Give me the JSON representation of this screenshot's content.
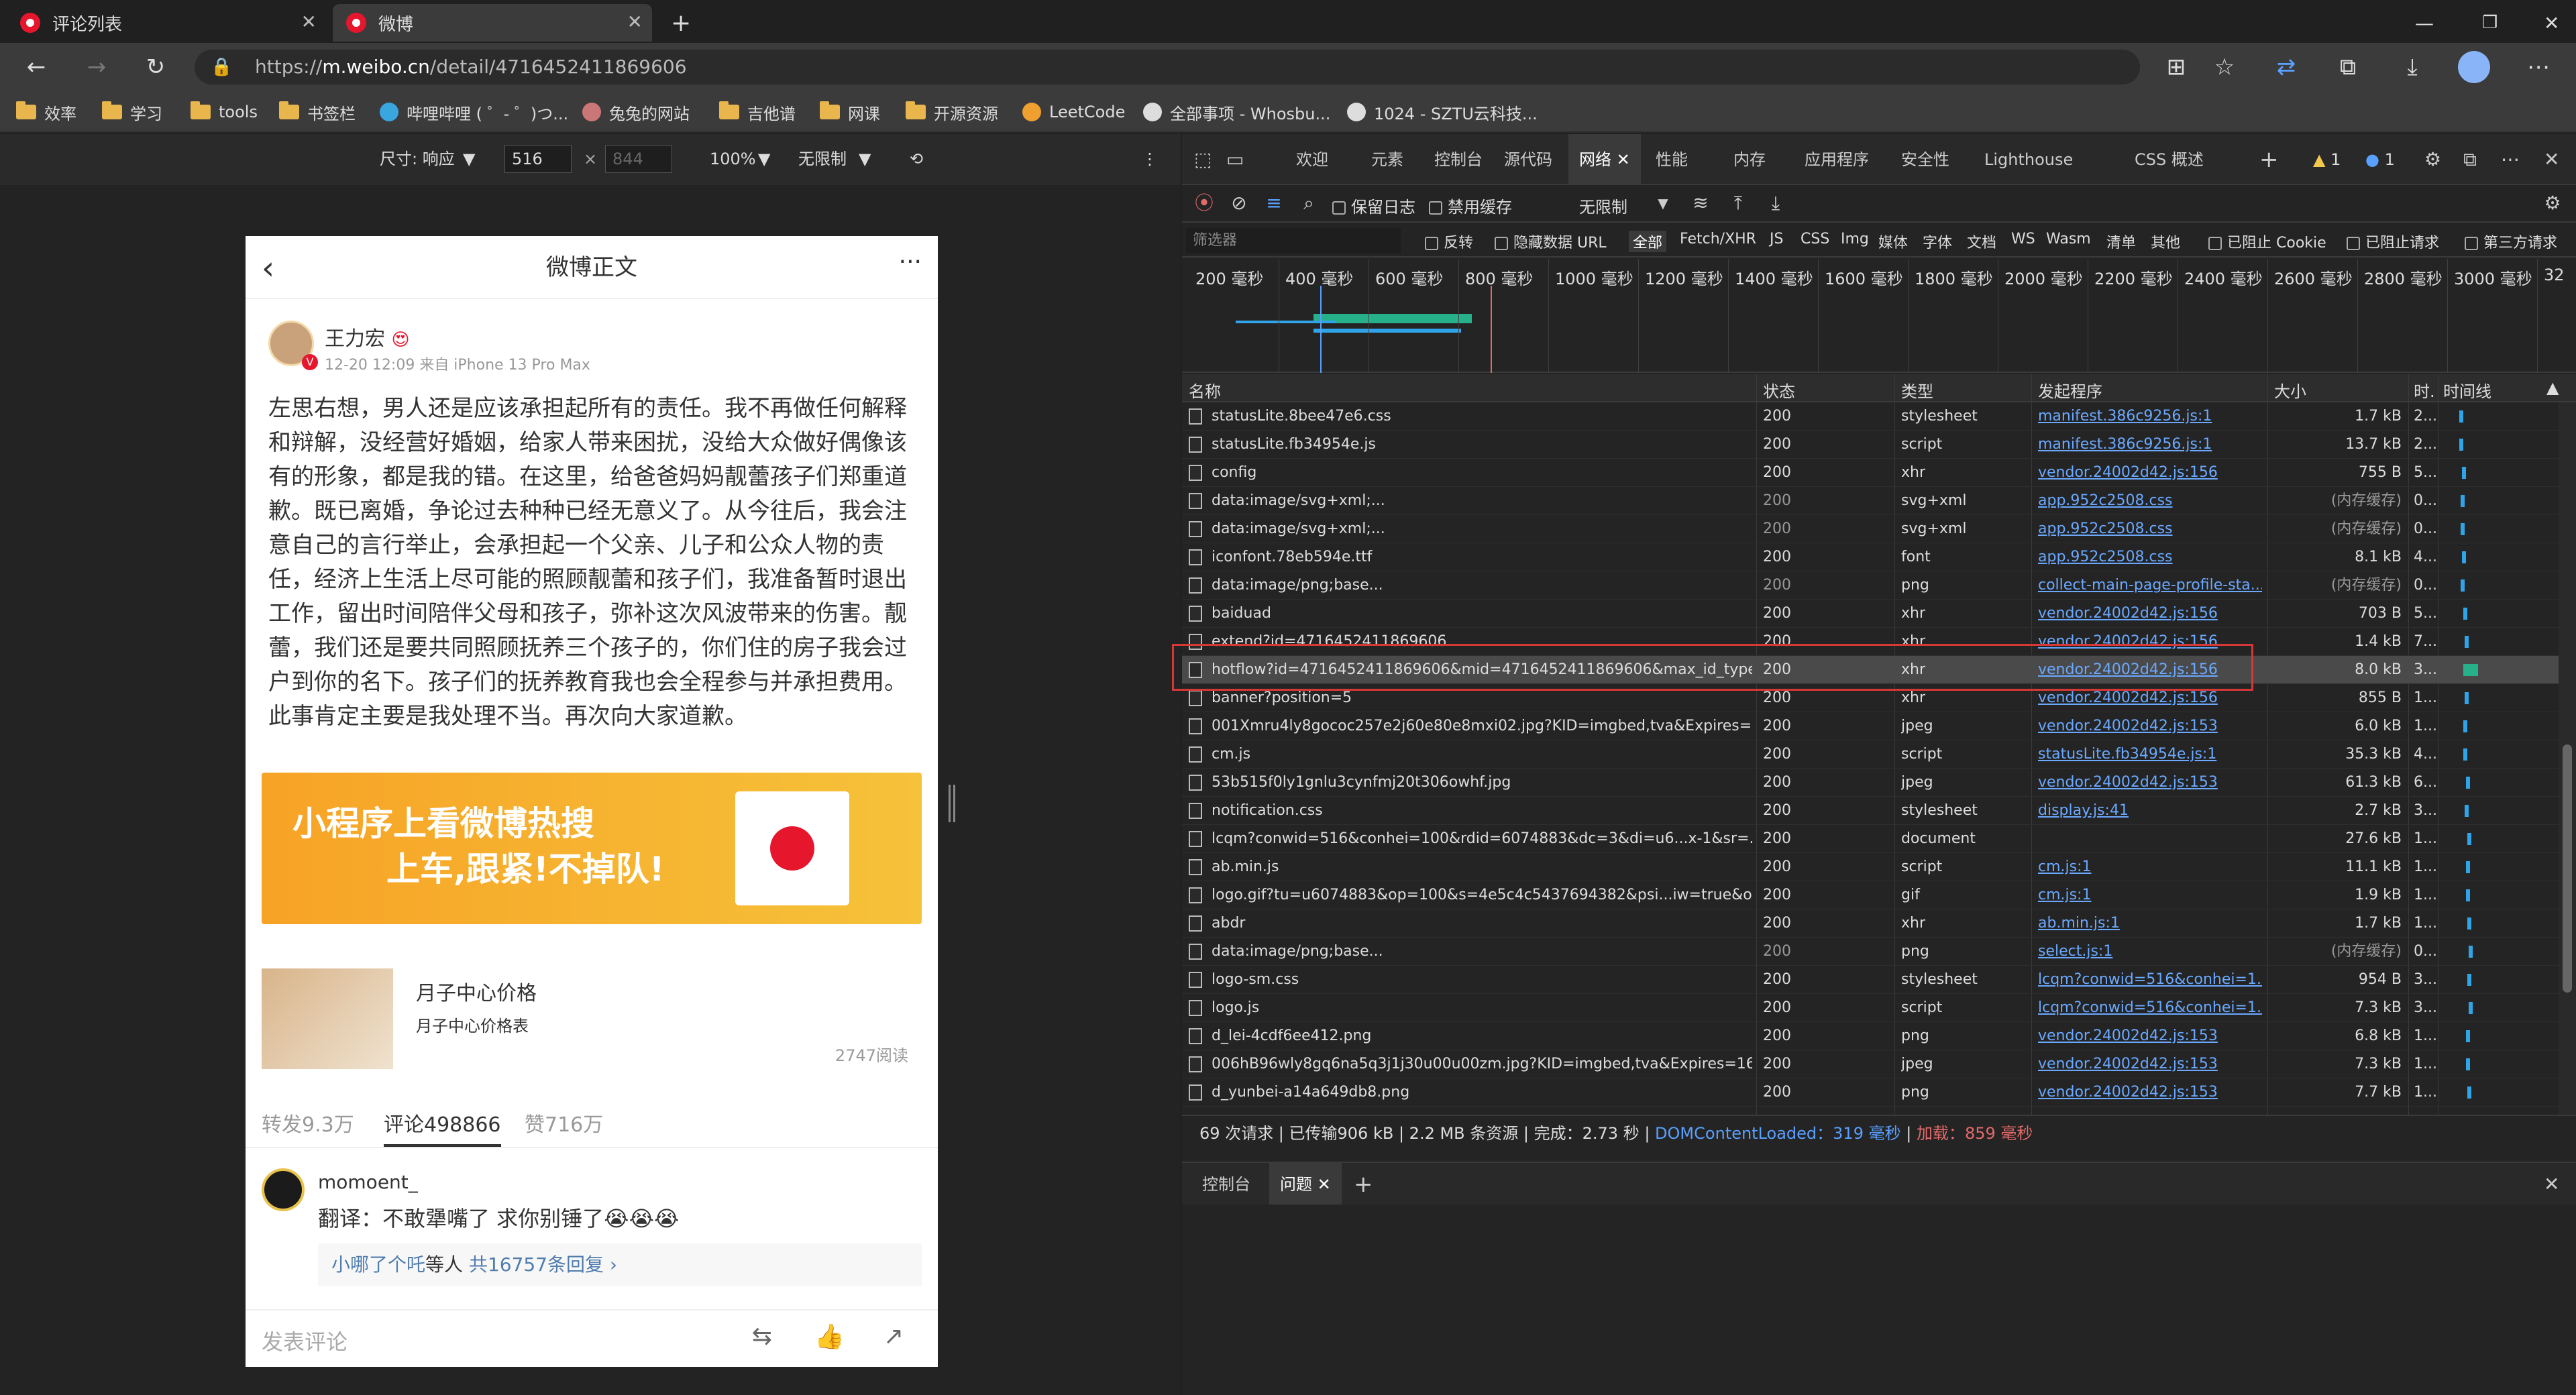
{
  "tabs": [
    {
      "label": "评论列表",
      "active": false
    },
    {
      "label": "微博",
      "active": true
    }
  ],
  "address": {
    "url": "https://m.weibo.cn/detail/4716452411869606",
    "url_host": "m.weibo.cn",
    "url_scheme": "https://",
    "url_path": "/detail/4716452411869606"
  },
  "bookmarks": [
    "效率",
    "学习",
    "tools",
    "书签栏",
    "哔哩哔哩 ( ゜- ゜)つ...",
    "兔兔的网站",
    "吉他谱",
    "网课",
    "开源资源",
    "LeetCode",
    "全部事项 - Whosbu...",
    "1024 - SZTU云科技..."
  ],
  "device_toolbar": {
    "size_label": "尺寸: 响应",
    "width": "516",
    "height_placeholder": "844",
    "zoom": "100%",
    "throttle": "无限制"
  },
  "weibo": {
    "header_title": "微博正文",
    "user": "王力宏",
    "meta": "12-20 12:09 来自 iPhone 13 Pro Max",
    "text": "左思右想，男人还是应该承担起所有的责任。我不再做任何解释和辩解，没经营好婚姻，给家人带来困扰，没给大众做好偶像该有的形象，都是我的错。在这里，给爸爸妈妈靓蕾孩子们郑重道歉。既已离婚，争论过去种种已经无意义了。从今往后，我会注意自己的言行举止，会承担起一个父亲、儿子和公众人物的责任，经济上生活上尽可能的照顾靓蕾和孩子们，我准备暂时退出工作，留出时间陪伴父母和孩子，弥补这次风波带来的伤害。靓蕾，我们还是要共同照顾抚养三个孩子的，你们住的房子我会过户到你的名下。孩子们的抚养教育我也会全程参与并承担费用。此事肯定主要是我处理不当。再次向大家道歉。",
    "banner_line1": "小程序上看微博热搜",
    "banner_line2": "上车,跟紧!不掉队!",
    "ad_title": "月子中心价格",
    "ad_sub": "月子中心价格表",
    "ad_reads": "2747阅读",
    "reposts": "转发9.3万",
    "comments": "评论498866",
    "likes": "赞716万",
    "comment_user": "momoent_",
    "comment_text": "翻译：不敢犟嘴了 求你别锤了😭😭😭",
    "reply_user": "小哪了个吒",
    "reply_mid": "等人",
    "reply_count": "共16757条回复 ›",
    "composer_placeholder": "发表评论"
  },
  "devtools": {
    "tabs": [
      "欢迎",
      "元素",
      "控制台",
      "源代码",
      "网络",
      "性能",
      "内存",
      "应用程序",
      "安全性",
      "Lighthouse",
      "CSS 概述"
    ],
    "active_tab": "网络",
    "warnings": "1",
    "messages": "1",
    "toolbar": {
      "preserve_log": "保留日志",
      "disable_cache": "禁用缓存",
      "throttle": "无限制"
    },
    "filter_placeholder": "筛选器",
    "filter_opts": [
      "反转",
      "隐藏数据 URL",
      "全部",
      "Fetch/XHR",
      "JS",
      "CSS",
      "Img",
      "媒体",
      "字体",
      "文档",
      "WS",
      "Wasm",
      "清单",
      "其他",
      "已阻止 Cookie",
      "已阻止请求",
      "第三方请求"
    ],
    "timeline_ticks": [
      "200 毫秒",
      "400 毫秒",
      "600 毫秒",
      "800 毫秒",
      "1000 毫秒",
      "1200 毫秒",
      "1400 毫秒",
      "1600 毫秒",
      "1800 毫秒",
      "2000 毫秒",
      "2200 毫秒",
      "2400 毫秒",
      "2600 毫秒",
      "2800 毫秒",
      "3000 毫秒",
      "32"
    ],
    "columns": [
      "名称",
      "状态",
      "类型",
      "发起程序",
      "大小",
      "时.",
      "时间线"
    ],
    "rows": [
      {
        "name": "statusLite.8bee47e6.css",
        "status": "200",
        "type": "stylesheet",
        "initiator": "manifest.386c9256.js:1",
        "size": "1.7 kB",
        "time": "2..."
      },
      {
        "name": "statusLite.fb34954e.js",
        "status": "200",
        "type": "script",
        "initiator": "manifest.386c9256.js:1",
        "size": "13.7 kB",
        "time": "2..."
      },
      {
        "name": "config",
        "status": "200",
        "type": "xhr",
        "initiator": "vendor.24002d42.js:156",
        "size": "755 B",
        "time": "5..."
      },
      {
        "name": "data:image/svg+xml;...",
        "status": "200",
        "type": "svg+xml",
        "initiator": "app.952c2508.css",
        "size": "(内存缓存)",
        "time": "0..."
      },
      {
        "name": "data:image/svg+xml;...",
        "status": "200",
        "type": "svg+xml",
        "initiator": "app.952c2508.css",
        "size": "(内存缓存)",
        "time": "0..."
      },
      {
        "name": "iconfont.78eb594e.ttf",
        "status": "200",
        "type": "font",
        "initiator": "app.952c2508.css",
        "size": "8.1 kB",
        "time": "4..."
      },
      {
        "name": "data:image/png;base...",
        "status": "200",
        "type": "png",
        "initiator": "collect-main-page-profile-sta...",
        "size": "(内存缓存)",
        "time": "0..."
      },
      {
        "name": "baiduad",
        "status": "200",
        "type": "xhr",
        "initiator": "vendor.24002d42.js:156",
        "size": "703 B",
        "time": "5..."
      },
      {
        "name": "extend?id=4716452411869606",
        "status": "200",
        "type": "xhr",
        "initiator": "vendor.24002d42.js:156",
        "size": "1.4 kB",
        "time": "7..."
      },
      {
        "name": "hotflow?id=4716452411869606&mid=4716452411869606&max_id_type...",
        "status": "200",
        "type": "xhr",
        "initiator": "vendor.24002d42.js:156",
        "size": "8.0 kB",
        "time": "3..."
      },
      {
        "name": "banner?position=5",
        "status": "200",
        "type": "xhr",
        "initiator": "vendor.24002d42.js:156",
        "size": "855 B",
        "time": "1..."
      },
      {
        "name": "001Xmru4ly8gococ257e2j60e80e8mxi02.jpg?KID=imgbed,tva&Expires=1...",
        "status": "200",
        "type": "jpeg",
        "initiator": "vendor.24002d42.js:153",
        "size": "6.0 kB",
        "time": "1..."
      },
      {
        "name": "cm.js",
        "status": "200",
        "type": "script",
        "initiator": "statusLite.fb34954e.js:1",
        "size": "35.3 kB",
        "time": "4..."
      },
      {
        "name": "53b515f0ly1gnlu3cynfmj20t306owhf.jpg",
        "status": "200",
        "type": "jpeg",
        "initiator": "vendor.24002d42.js:153",
        "size": "61.3 kB",
        "time": "6..."
      },
      {
        "name": "notification.css",
        "status": "200",
        "type": "stylesheet",
        "initiator": "display.js:41",
        "size": "2.7 kB",
        "time": "3..."
      },
      {
        "name": "lcqm?conwid=516&conhei=100&rdid=6074883&dc=3&di=u6...x-1&sr=...",
        "status": "200",
        "type": "document",
        "initiator": "",
        "size": "27.6 kB",
        "time": "1..."
      },
      {
        "name": "ab.min.js",
        "status": "200",
        "type": "script",
        "initiator": "cm.js:1",
        "size": "11.1 kB",
        "time": "1..."
      },
      {
        "name": "logo.gif?tu=u6074883&op=100&s=4e5c4c5437694382&psi...iw=true&o...",
        "status": "200",
        "type": "gif",
        "initiator": "cm.js:1",
        "size": "1.9 kB",
        "time": "1..."
      },
      {
        "name": "abdr",
        "status": "200",
        "type": "xhr",
        "initiator": "ab.min.js:1",
        "size": "1.7 kB",
        "time": "1..."
      },
      {
        "name": "data:image/png;base...",
        "status": "200",
        "type": "png",
        "initiator": "select.js:1",
        "size": "(内存缓存)",
        "time": "0..."
      },
      {
        "name": "logo-sm.css",
        "status": "200",
        "type": "stylesheet",
        "initiator": "lcqm?conwid=516&conhei=1...",
        "size": "954 B",
        "time": "3..."
      },
      {
        "name": "logo.js",
        "status": "200",
        "type": "script",
        "initiator": "lcqm?conwid=516&conhei=1...",
        "size": "7.3 kB",
        "time": "3..."
      },
      {
        "name": "d_lei-4cdf6ee412.png",
        "status": "200",
        "type": "png",
        "initiator": "vendor.24002d42.js:153",
        "size": "6.8 kB",
        "time": "1..."
      },
      {
        "name": "006hB96wly8gq6na5q3j1j30u00u00zm.jpg?KID=imgbed,tva&Expires=16...",
        "status": "200",
        "type": "jpeg",
        "initiator": "vendor.24002d42.js:153",
        "size": "7.3 kB",
        "time": "1..."
      },
      {
        "name": "d_yunbei-a14a649db8.png",
        "status": "200",
        "type": "png",
        "initiator": "vendor.24002d42.js:153",
        "size": "7.7 kB",
        "time": "1..."
      }
    ],
    "status_bar": {
      "requests": "69 次请求",
      "transferred": "已传输906 kB",
      "resources": "2.2 MB 条资源",
      "finish": "完成：2.73 秒",
      "dcl_label": "DOMContentLoaded：",
      "dcl_val": "319 毫秒",
      "load_label": "加载：",
      "load_val": "859 毫秒"
    },
    "drawer_tabs": [
      "控制台",
      "问题"
    ],
    "drawer_active": "问题"
  }
}
